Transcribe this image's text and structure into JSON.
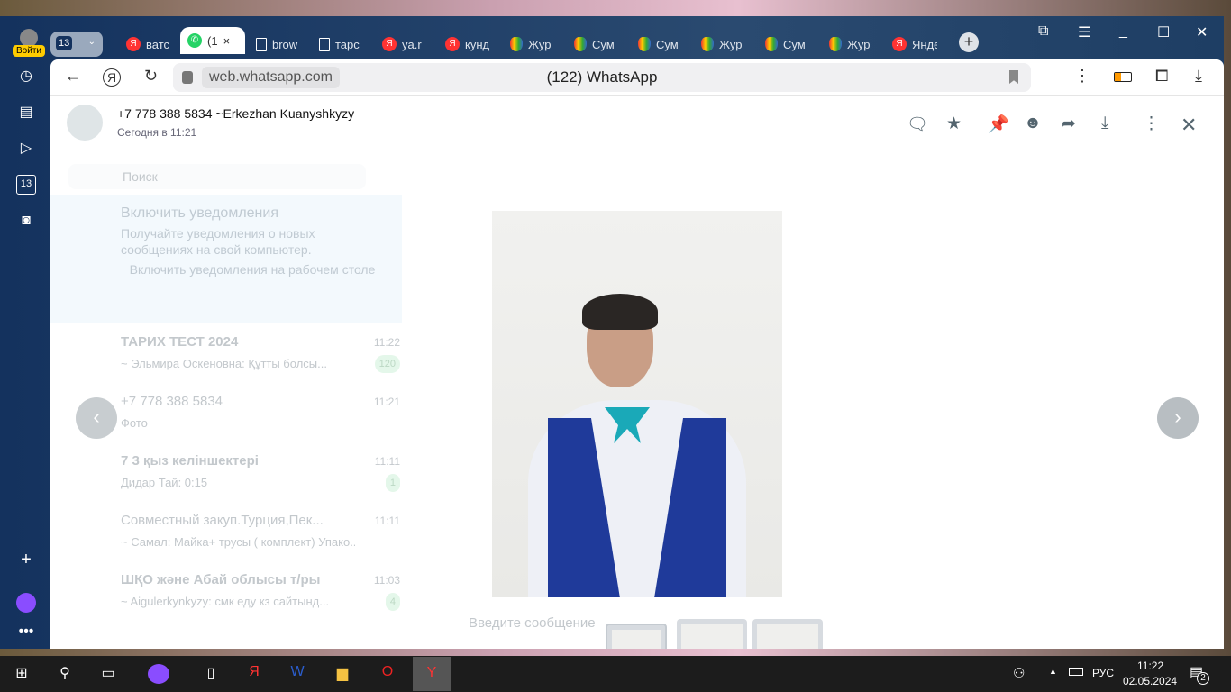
{
  "browser": {
    "login_label": "Войти",
    "tab_count": "13",
    "tabs": [
      {
        "label": "ватс",
        "icon": "yandex"
      },
      {
        "label": "(1",
        "icon": "whatsapp",
        "active": true
      },
      {
        "label": "brow",
        "icon": "doc"
      },
      {
        "label": "тарс",
        "icon": "doc"
      },
      {
        "label": "ya.r",
        "icon": "yandex"
      },
      {
        "label": "кунд",
        "icon": "yandex"
      },
      {
        "label": "Жур",
        "icon": "hand"
      },
      {
        "label": "Сум",
        "icon": "hand"
      },
      {
        "label": "Сум",
        "icon": "hand"
      },
      {
        "label": "Жур",
        "icon": "hand"
      },
      {
        "label": "Сум",
        "icon": "hand"
      },
      {
        "label": "Жур",
        "icon": "hand"
      },
      {
        "label": "Янде",
        "icon": "yandex"
      }
    ],
    "url": "web.whatsapp.com",
    "page_title": "(122) WhatsApp"
  },
  "viewer": {
    "contact": "+7 778 388 5834 ~Erkezhan Kuanyshkyzy",
    "time": "Сегодня в 11:21",
    "thumbnails": 3,
    "selected_thumbnail": 1
  },
  "chats": {
    "search_placeholder": "Поиск",
    "banner": {
      "title": "Включить уведомления",
      "text": "Получайте уведомления о новых сообщениях на свой компьютер.",
      "link": "Включить уведомления на рабочем столе"
    },
    "items": [
      {
        "name": "ТАРИХ ТЕСТ 2024",
        "preview": "~ Эльмира Оскеновна: Құтты болсы...",
        "time": "11:22",
        "unread": "120"
      },
      {
        "name": "+7 778 388 5834",
        "preview": "Фото",
        "time": "11:21",
        "unread": ""
      },
      {
        "name": "7 3 қыз келіншектері",
        "preview": "Дидар Тай: 0:15",
        "time": "11:11",
        "unread": "1"
      },
      {
        "name": "Совместный закуп.Турция,Пек...",
        "preview": "~ Самал: Майка+ трусы ( комплект) Упако...",
        "time": "11:11",
        "unread": ""
      },
      {
        "name": "ШҚО және Абай облысы т/ры",
        "preview": "~ Aigulerkynkyzy: смк еду кз сайтынд...",
        "time": "11:03",
        "unread": "4"
      }
    ],
    "compose_placeholder": "Введите сообщение"
  },
  "taskbar": {
    "lang": "РУС",
    "time": "11:22",
    "date": "02.05.2024",
    "notifications": "2"
  },
  "colors": {
    "sidebar": "#14325e",
    "whatsapp_green": "#25d366",
    "taskbar": "#1c1c1c"
  }
}
